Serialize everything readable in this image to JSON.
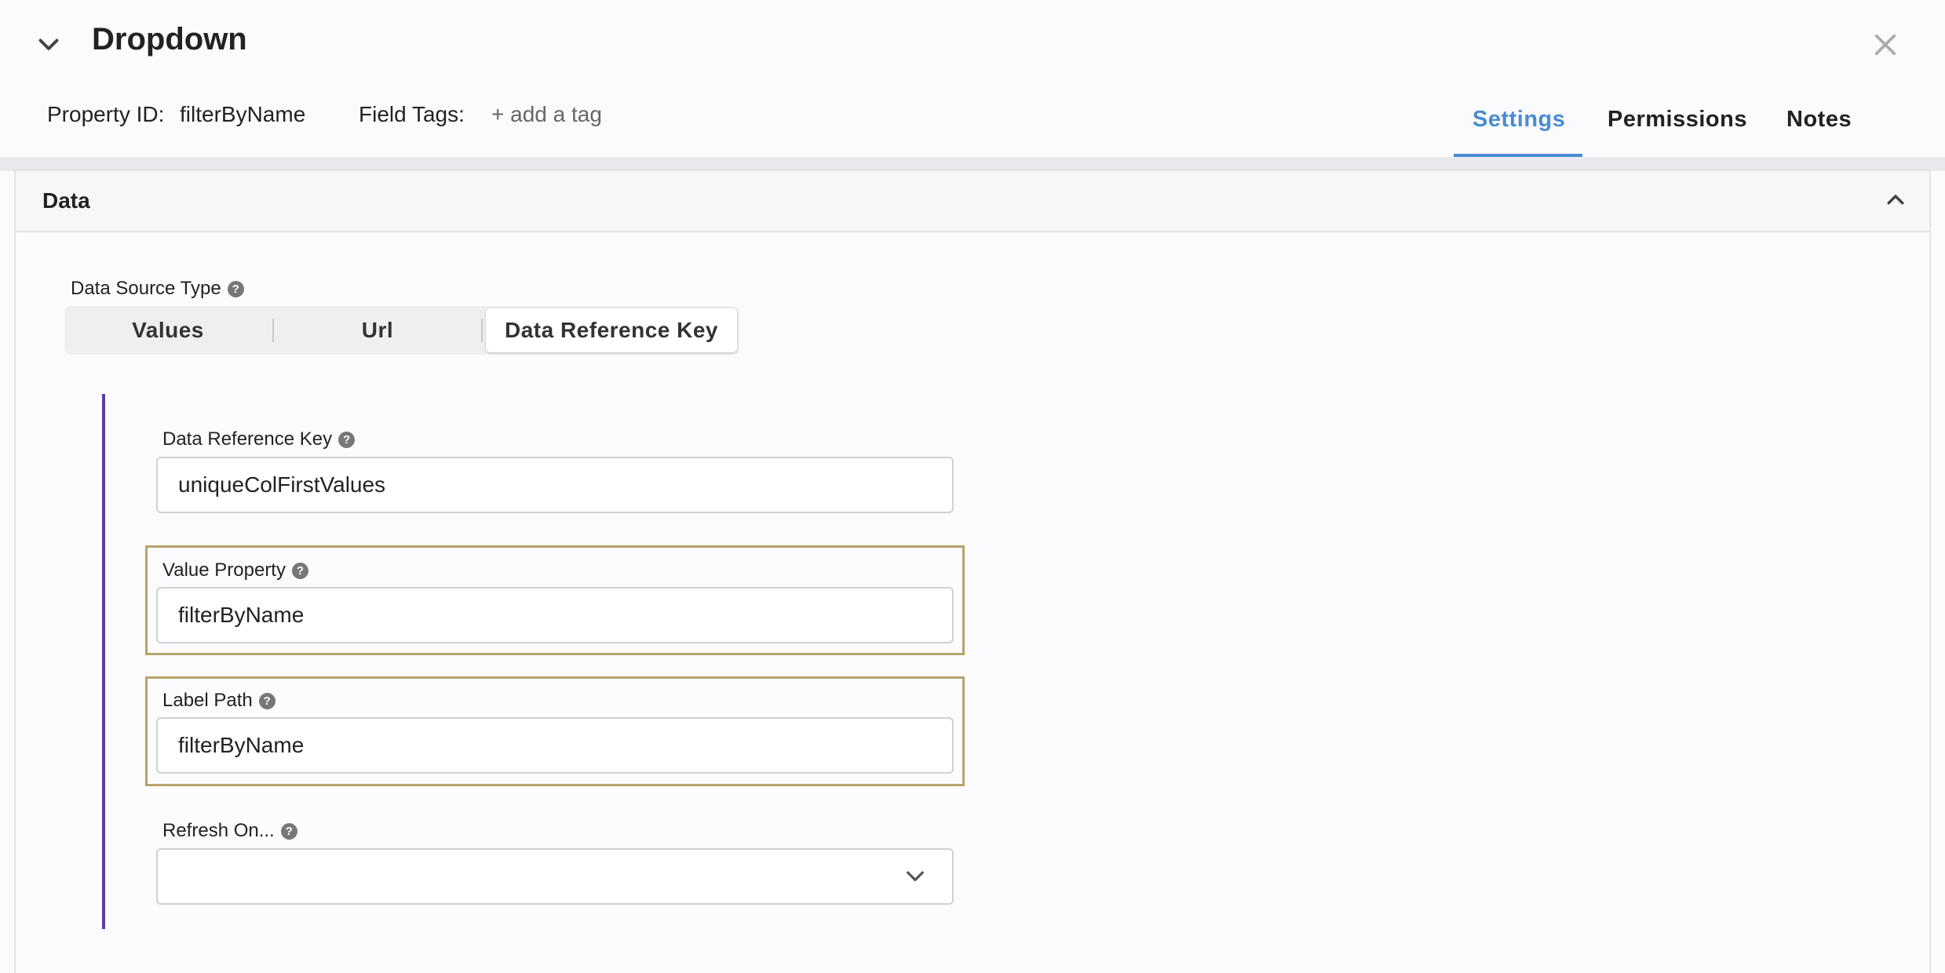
{
  "header": {
    "title": "Dropdown",
    "property_id_label": "Property ID:",
    "property_id_value": "filterByName",
    "field_tags_label": "Field Tags:",
    "add_tag_label": "+ add a tag"
  },
  "tabs": [
    {
      "label": "Settings",
      "active": true
    },
    {
      "label": "Permissions",
      "active": false
    },
    {
      "label": "Notes",
      "active": false
    }
  ],
  "panel": {
    "title": "Data"
  },
  "data_source_type": {
    "label": "Data Source Type",
    "options": [
      "Values",
      "Url",
      "Data Reference Key"
    ],
    "selected": "Data Reference Key"
  },
  "fields": {
    "data_reference_key": {
      "label": "Data Reference Key",
      "value": "uniqueColFirstValues"
    },
    "value_property": {
      "label": "Value Property",
      "value": "filterByName"
    },
    "label_path": {
      "label": "Label Path",
      "value": "filterByName"
    },
    "refresh_on": {
      "label": "Refresh On...",
      "value": ""
    }
  },
  "colors": {
    "accent": "#4a8cd3",
    "rail": "#5b3fa6",
    "highlight_border": "#b5a46a"
  },
  "icons": {
    "collapse": "chevron-down-icon",
    "close": "close-icon",
    "panel_toggle": "chevron-up-icon",
    "help": "question-circle-icon",
    "select": "chevron-down-icon"
  }
}
